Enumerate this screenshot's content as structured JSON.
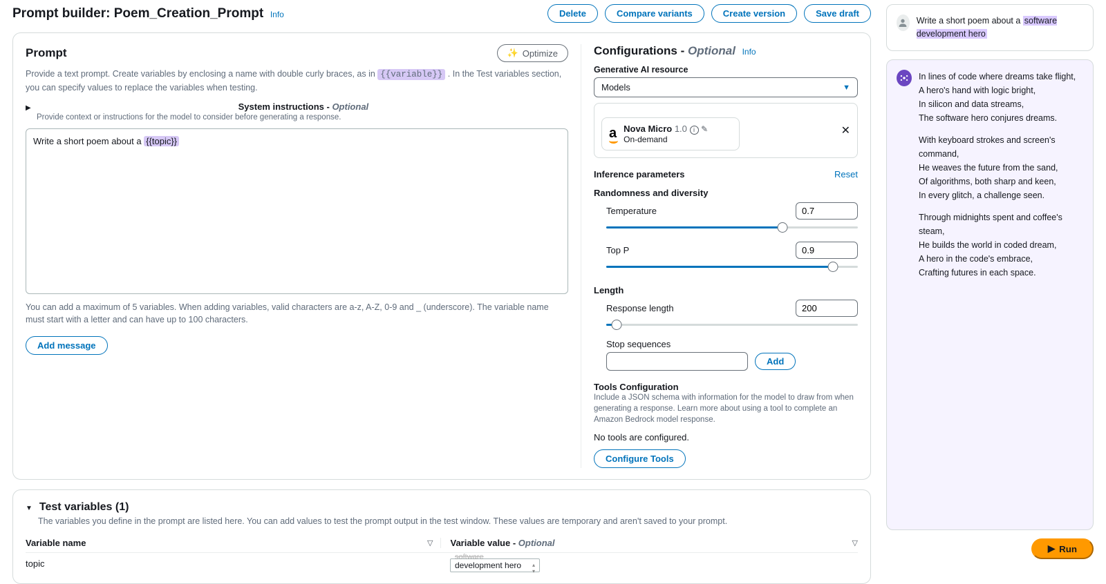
{
  "header": {
    "title_prefix": "Prompt builder: ",
    "title_name": "Poem_Creation_Prompt",
    "info": "Info",
    "buttons": {
      "delete": "Delete",
      "compare": "Compare variants",
      "create": "Create version",
      "save": "Save draft"
    }
  },
  "prompt": {
    "heading": "Prompt",
    "optimize": "Optimize",
    "desc_pre": "Provide a text prompt. Create variables by enclosing a name with double curly braces, as in ",
    "desc_var": "{{variable}}",
    "desc_post": " . In the Test variables section, you can specify values to replace the variables when testing.",
    "sys_instr_label": "System instructions - ",
    "sys_instr_optional": "Optional",
    "sys_instr_sub": "Provide context or instructions for the model to consider before generating a response.",
    "text_pre": "Write a short poem about a ",
    "text_var": "{{topic}}",
    "limits": "You can add a maximum of 5 variables. When adding variables, valid characters are a-z, A-Z, 0-9 and _ (underscore). The variable name must start with a letter and can have up to 100 characters.",
    "add_message": "Add message"
  },
  "config": {
    "heading_pre": "Configurations - ",
    "heading_em": "Optional",
    "info": "Info",
    "gen_ai_label": "Generative AI resource",
    "models": "Models",
    "model_name": "Nova Micro",
    "model_ver": "1.0",
    "model_mode": "On-demand",
    "infer_label": "Inference parameters",
    "reset": "Reset",
    "rand_div": "Randomness and diversity",
    "temperature_label": "Temperature",
    "temperature_value": "0.7",
    "temperature_pct": 70,
    "topp_label": "Top P",
    "topp_value": "0.9",
    "topp_pct": 90,
    "length_heading": "Length",
    "resp_len_label": "Response length",
    "resp_len_value": "200",
    "resp_len_pct": 4,
    "stop_label": "Stop sequences",
    "add": "Add",
    "tools_heading": "Tools Configuration",
    "tools_desc": "Include a JSON schema with information for the model to draw from when generating a response. Learn more about using a tool to complete an Amazon Bedrock model response.",
    "tools_none": "No tools are configured.",
    "configure_tools": "Configure Tools"
  },
  "testvars": {
    "heading": "Test variables (1)",
    "desc": "The variables you define in the prompt are listed here. You can add values to test the prompt output in the test window. These values are temporary and aren't saved to your prompt.",
    "col_name": "Variable name",
    "col_val_pre": "Variable value - ",
    "col_val_em": "Optional",
    "row_name": "topic",
    "row_val_trunc": "software",
    "row_val": "development hero"
  },
  "chat": {
    "user_pre": "Write a short poem about a ",
    "user_hl": "software development hero",
    "poem_s1": "In lines of code where dreams take flight,\nA hero's hand with logic bright,\nIn silicon and data streams,\nThe software hero conjures dreams.",
    "poem_s2": "With keyboard strokes and screen's command,\nHe weaves the future from the sand,\nOf algorithms, both sharp and keen,\nIn every glitch, a challenge seen.",
    "poem_s3": "Through midnights spent and coffee's steam,\nHe builds the world in coded dream,\nA hero in the code's embrace,\nCrafting futures in each space."
  },
  "run": "Run"
}
